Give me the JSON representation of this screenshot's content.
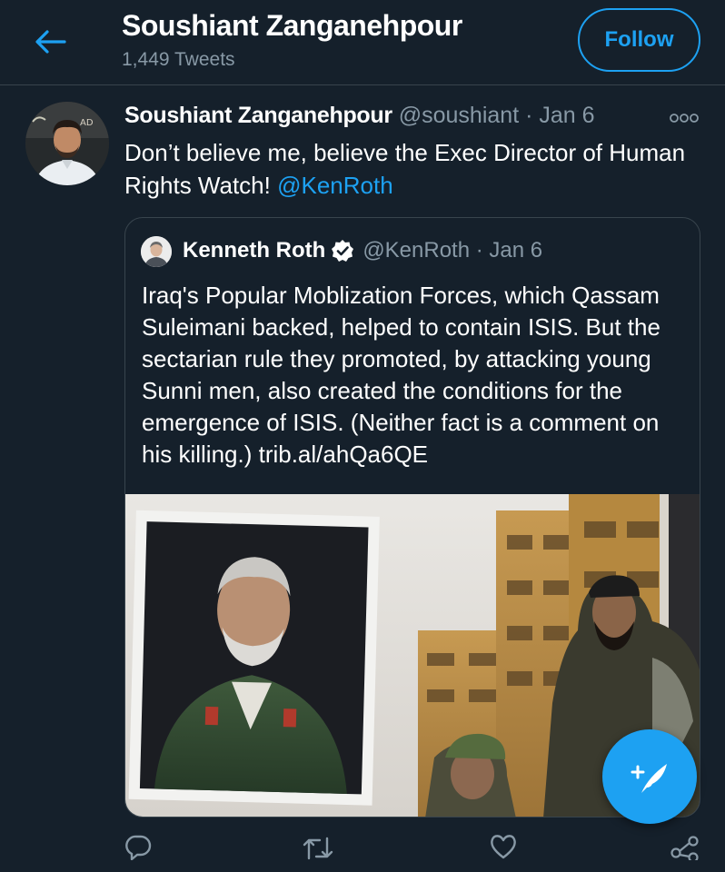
{
  "header": {
    "back_icon": "arrow-left-icon",
    "title": "Soushiant Zanganehpour",
    "tweet_count": "1,449 Tweets",
    "follow_label": "Follow"
  },
  "tweet": {
    "author_name": "Soushiant Zanganehpour",
    "author_handle": "@soushiant",
    "separator": "·",
    "date": "Jan 6",
    "text": "Don’t believe me, believe the Exec Director of Human Rights Watch! ",
    "mention": "@KenRoth",
    "more_icon": "more-horizontal-icon"
  },
  "quoted_tweet": {
    "author_name": "Kenneth Roth",
    "verified_icon": "verified-badge-icon",
    "meta": "@KenRoth · Jan 6",
    "text": "Iraq's Popular Moblization Forces, which Qassam Suleimani backed, helped to contain ISIS. But the sectarian rule they promoted, by attacking young Sunni men, also created the conditions for the emergence of ISIS. (Neither fact is a comment on his killing.) trib.al/ahQa6QE"
  },
  "actions": {
    "reply_icon": "reply-icon",
    "retweet_icon": "retweet-icon",
    "like_icon": "heart-icon",
    "share_icon": "share-icon",
    "compose_icon": "compose-tweet-icon"
  },
  "colors": {
    "background": "#15202b",
    "accent": "#1da1f2",
    "secondary_text": "#8899a6",
    "border": "#38444d"
  }
}
